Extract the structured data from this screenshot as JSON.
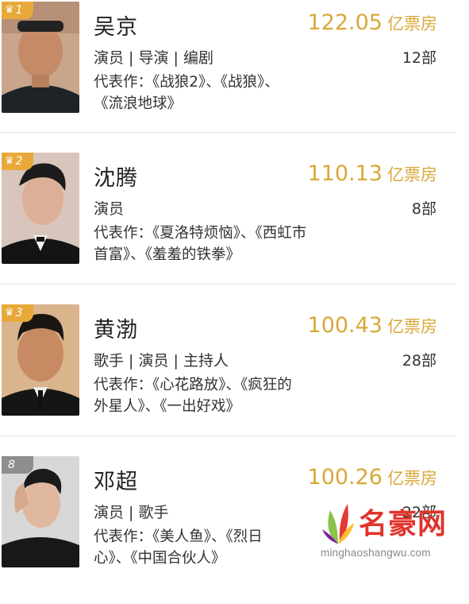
{
  "colors": {
    "box_office": "#d9a838",
    "badge_top": "#e7a93a",
    "badge_other": "#8e8e8e",
    "watermark": "#e0342c"
  },
  "actors": [
    {
      "rank": "1",
      "name": "吴京",
      "box_office": "122.05",
      "unit": "亿票房",
      "roles": "演员 | 导演 | 编剧",
      "count": "12部",
      "works_line1": "代表作：《战狼2》、《战狼》、",
      "works_line2": "《流浪地球》"
    },
    {
      "rank": "2",
      "name": "沈腾",
      "box_office": "110.13",
      "unit": "亿票房",
      "roles": "演员",
      "count": "8部",
      "works_line1": "代表作：《夏洛特烦恼》、《西虹市",
      "works_line2": "首富》、《羞羞的铁拳》"
    },
    {
      "rank": "3",
      "name": "黄渤",
      "box_office": "100.43",
      "unit": "亿票房",
      "roles": "歌手 | 演员 | 主持人",
      "count": "28部",
      "works_line1": "代表作：《心花路放》、《疯狂的",
      "works_line2": "外星人》、《一出好戏》"
    },
    {
      "rank": "8",
      "name": "邓超",
      "box_office": "100.26",
      "unit": "亿票房",
      "roles": "演员 | 歌手",
      "count": "22部",
      "works_line1": "代表作：《美人鱼》、《烈日",
      "works_line2": "心》、《中国合伙人》"
    }
  ],
  "watermark": {
    "name": "名豪网",
    "url": "minghaoshangwu.com",
    "logo_icon": "leaf-logo-icon"
  }
}
